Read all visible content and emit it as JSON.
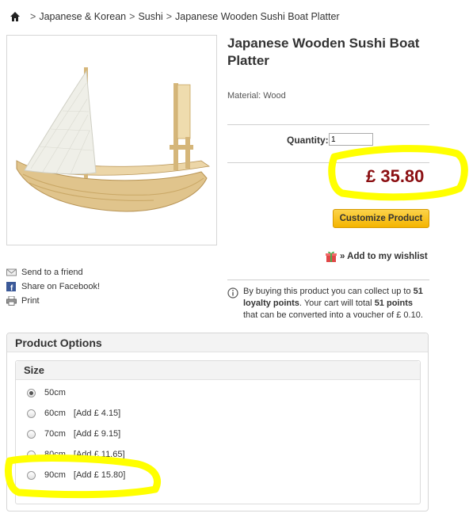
{
  "breadcrumb": {
    "items": [
      "Japanese & Korean",
      "Sushi",
      "Japanese Wooden Sushi Boat Platter"
    ],
    "separator": ">"
  },
  "product": {
    "title": "Japanese Wooden Sushi Boat Platter",
    "material": "Material: Wood",
    "quantity_label": "Quantity:",
    "quantity_value": "1",
    "price": "£ 35.80",
    "price_color": "#8b0f12"
  },
  "buttons": {
    "customize": "Customize Product",
    "wishlist": "» Add to my wishlist"
  },
  "actions": {
    "send_friend": "Send to a friend",
    "share_facebook": "Share on Facebook!",
    "print": "Print"
  },
  "loyalty": {
    "part1": "By buying this product you can collect up to ",
    "points": "51 loyalty points",
    "part2": ". Your cart will total ",
    "total_points": "51 points",
    "part3": " that can be converted into a voucher of £ 0.10."
  },
  "options": {
    "panel_title": "Product Options",
    "group_title": "Size",
    "items": [
      {
        "label": "50cm",
        "add": "",
        "checked": true
      },
      {
        "label": "60cm",
        "add": "[Add £ 4.15]",
        "checked": false
      },
      {
        "label": "70cm",
        "add": "[Add £ 9.15]",
        "checked": false
      },
      {
        "label": "80cm",
        "add": "[Add £ 11.65]",
        "checked": false
      },
      {
        "label": "90cm",
        "add": "[Add £ 15.80]",
        "checked": false
      }
    ]
  },
  "colors": {
    "button": "#f4b400",
    "highlighter": "#ffff00"
  }
}
